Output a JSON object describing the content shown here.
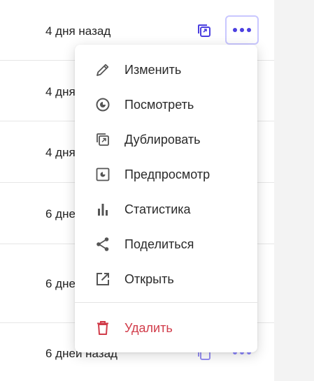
{
  "rows": [
    {
      "time": "4 дня назад"
    },
    {
      "time": "4 дня"
    },
    {
      "time": "4 дня"
    },
    {
      "time": "6 дне"
    },
    {
      "time": "6 дне"
    },
    {
      "time": "6 дней назад"
    }
  ],
  "menu": {
    "items": [
      {
        "label": "Изменить",
        "icon": "pencil-icon"
      },
      {
        "label": "Посмотреть",
        "icon": "eye-icon"
      },
      {
        "label": "Дублировать",
        "icon": "duplicate-icon"
      },
      {
        "label": "Предпросмотр",
        "icon": "preview-icon"
      },
      {
        "label": "Статистика",
        "icon": "statistics-icon"
      },
      {
        "label": "Поделиться",
        "icon": "share-icon"
      },
      {
        "label": "Открыть",
        "icon": "open-external-icon"
      }
    ],
    "delete": {
      "label": "Удалить",
      "icon": "trash-icon"
    }
  },
  "colors": {
    "accent": "#4b3fe0",
    "danger": "#d13c4a",
    "icon_gray": "#555555"
  }
}
